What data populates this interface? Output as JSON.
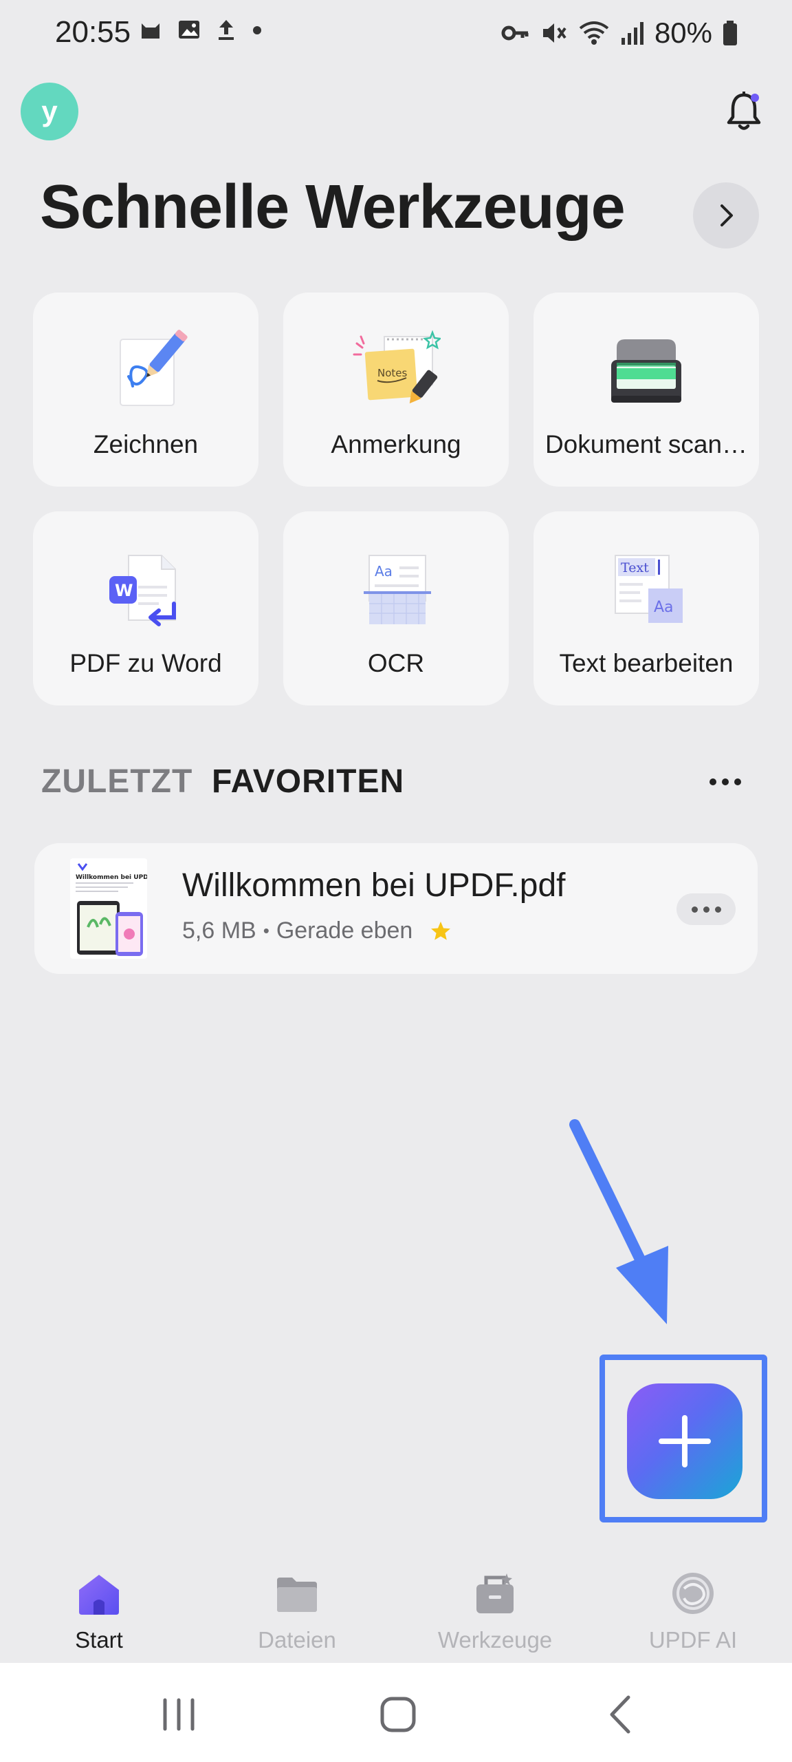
{
  "status_bar": {
    "time": "20:55",
    "battery": "80%",
    "left_icons": [
      "cat-icon",
      "image-icon",
      "upload-icon",
      "dot-icon"
    ],
    "right_icons": [
      "key-icon",
      "mute-icon",
      "wifi-icon",
      "signal-icon",
      "battery-icon"
    ]
  },
  "header": {
    "avatar_letter": "y",
    "title": "Schnelle Werkzeuge"
  },
  "tools": [
    {
      "label": "Zeichnen",
      "icon": "draw-icon"
    },
    {
      "label": "Anmerkung",
      "icon": "notes-icon",
      "icon_text": "Notes"
    },
    {
      "label": "Dokument scan…",
      "icon": "scanner-icon"
    },
    {
      "label": "PDF zu Word",
      "icon": "pdf-to-word-icon",
      "icon_text": "W"
    },
    {
      "label": "OCR",
      "icon": "ocr-icon",
      "icon_text": "Aa"
    },
    {
      "label": "Text bearbeiten",
      "icon": "edit-text-icon",
      "icon_text_1": "Text",
      "icon_text_2": "Aa"
    }
  ],
  "tabs": {
    "recent": "ZULETZT",
    "favorites": "FAVORITEN",
    "active": "favorites"
  },
  "files": [
    {
      "name": "Willkommen bei UPDF.pdf",
      "size": "5,6 MB",
      "separator": "•",
      "time": "Gerade eben",
      "favorite": true,
      "thumb_title": "Willkommen bei UPDF"
    }
  ],
  "bottom_nav": [
    {
      "label": "Start",
      "icon": "home-icon",
      "active": true
    },
    {
      "label": "Dateien",
      "icon": "folder-icon",
      "active": false
    },
    {
      "label": "Werkzeuge",
      "icon": "toolbox-icon",
      "active": false
    },
    {
      "label": "UPDF AI",
      "icon": "ai-icon",
      "active": false
    }
  ],
  "colors": {
    "accent": "#6f5cf6",
    "annotation_blue": "#4f7ef5",
    "star": "#f7c416",
    "avatar": "#63d8bf"
  }
}
